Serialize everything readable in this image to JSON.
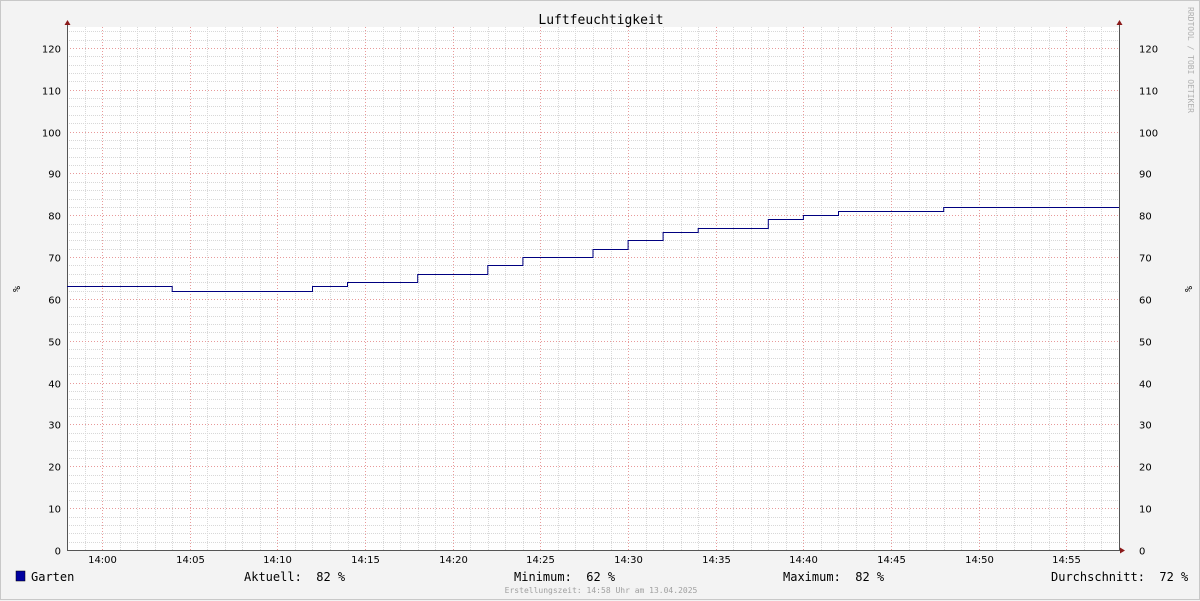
{
  "chart_data": {
    "type": "line",
    "title": "Luftfeuchtigkeit",
    "ylabel_left": "%",
    "ylabel_right": "%",
    "ylim": [
      0,
      125
    ],
    "y_ticks": [
      0,
      10,
      20,
      30,
      40,
      50,
      60,
      70,
      80,
      90,
      100,
      110,
      120
    ],
    "x_range": [
      "13:58",
      "14:58"
    ],
    "x_ticks": [
      "14:00",
      "14:05",
      "14:10",
      "14:15",
      "14:20",
      "14:25",
      "14:30",
      "14:35",
      "14:40",
      "14:45",
      "14:50",
      "14:55"
    ],
    "grid": true,
    "legend_position": "bottom-left",
    "series": [
      {
        "name": "Garten",
        "color": "#000080",
        "step": true,
        "x": [
          "13:58",
          "14:04",
          "14:12",
          "14:14",
          "14:18",
          "14:22",
          "14:24",
          "14:28",
          "14:30",
          "14:32",
          "14:34",
          "14:38",
          "14:40",
          "14:42",
          "14:48",
          "14:58"
        ],
        "values": [
          63,
          62,
          63,
          64,
          66,
          68,
          70,
          72,
          74,
          76,
          77,
          79,
          80,
          81,
          82,
          82
        ]
      }
    ]
  },
  "watermark": "RRDTOOL / TOBI OETIKER",
  "footer": {
    "legend_label": "Garten",
    "legend_color": "#0000a0",
    "current": "Aktuell:  82 %",
    "minimum": "Minimum:  62 %",
    "maximum": "Maximum:  82 %",
    "average": "Durchschnitt:  72 %",
    "created": "Erstellungszeit: 14:58 Uhr am 13.04.2025"
  }
}
